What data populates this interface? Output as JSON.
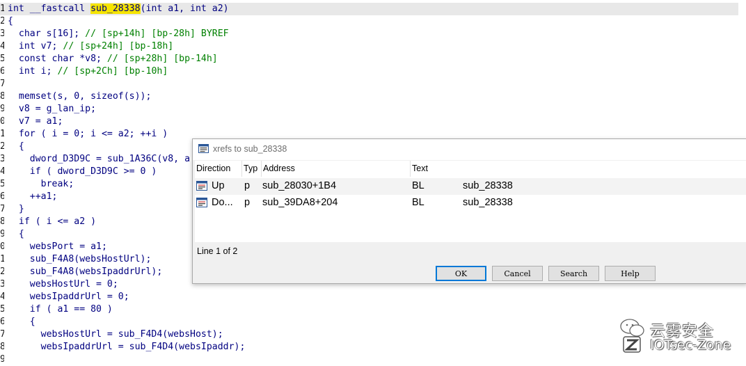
{
  "editor": {
    "line_numbers": [
      "1",
      "2",
      "3",
      "4",
      "5",
      "6",
      "7",
      "8",
      "9",
      "0",
      "1",
      "2",
      "3",
      "4",
      "5",
      "6",
      "7",
      "8",
      "9",
      "0",
      "1",
      "2",
      "3",
      "4",
      "5",
      "6",
      "7",
      "8",
      "9"
    ],
    "lines": [
      [
        "int __fastcall ",
        "sub_28338",
        "(int a1, int a2)"
      ],
      [
        "{"
      ],
      [
        "  char s[16]; ",
        "// [sp+14h] [bp-28h] BYREF"
      ],
      [
        "  int v7; ",
        "// [sp+24h] [bp-18h]"
      ],
      [
        "  const char *v8; ",
        "// [sp+28h] [bp-14h]"
      ],
      [
        "  int i; ",
        "// [sp+2Ch] [bp-10h]"
      ],
      [
        ""
      ],
      [
        "  memset(s, 0, sizeof(s));"
      ],
      [
        "  v8 = g_lan_ip;"
      ],
      [
        "  v7 = a1;"
      ],
      [
        "  for ( i = 0; i <= a2; ++i )"
      ],
      [
        "  {"
      ],
      [
        "    dword_D3D9C = sub_1A36C(v8, a"
      ],
      [
        "    if ( dword_D3D9C >= 0 )"
      ],
      [
        "      break;"
      ],
      [
        "    ++a1;"
      ],
      [
        "  }"
      ],
      [
        "  if ( i <= a2 )"
      ],
      [
        "  {"
      ],
      [
        "    websPort = a1;"
      ],
      [
        "    sub_F4A8(websHostUrl);"
      ],
      [
        "    sub_F4A8(websIpaddrUrl);"
      ],
      [
        "    websHostUrl = 0;"
      ],
      [
        "    websIpaddrUrl = 0;"
      ],
      [
        "    if ( a1 == 80 )"
      ],
      [
        "    {"
      ],
      [
        "      websHostUrl = sub_F4D4(websHost);"
      ],
      [
        "      websIpaddrUrl = sub_F4D4(websIpaddr);"
      ]
    ]
  },
  "dialog": {
    "title": "xrefs to sub_28338",
    "columns": [
      "Direction",
      "Typ",
      "Address",
      "Text"
    ],
    "rows": [
      {
        "direction": "Up",
        "type": "p",
        "address": "sub_28030+1B4",
        "instr": "BL",
        "target": "sub_28338"
      },
      {
        "direction": "Do...",
        "type": "p",
        "address": "sub_39DA8+204",
        "instr": "BL",
        "target": "sub_28338"
      }
    ],
    "status": "Line 1 of 2",
    "buttons": {
      "ok": "OK",
      "cancel": "Cancel",
      "search": "Search",
      "help": "Help"
    }
  },
  "watermark": {
    "line1": "云雾安全",
    "line2": "IOTsec-Zone"
  },
  "colors": {
    "highlight": "#f5e400",
    "comment": "#008000",
    "code": "#000080",
    "selection_border": "#0078d7"
  },
  "icons": {
    "dialog": "xref-window-icon",
    "row": "xref-entry-icon",
    "logo": "wechat-logo-icon"
  }
}
